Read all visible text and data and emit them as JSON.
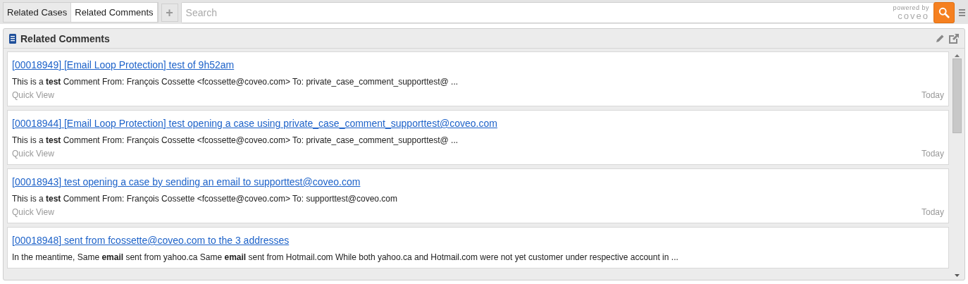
{
  "tabs": [
    {
      "label": "Related Cases",
      "selected": false
    },
    {
      "label": "Related Comments",
      "selected": true
    }
  ],
  "add_tab": "+",
  "search": {
    "placeholder": "Search",
    "powered_by": "powered by",
    "brand": "coveo"
  },
  "panel": {
    "title": "Related Comments",
    "results": [
      {
        "title": "[00018949] [Email Loop Protection] test of 9h52am",
        "excerpt": "This is a **test** Comment From: François Cossette <fcossette@coveo.com> To: private_case_comment_supporttest@ ...",
        "quick_view": "Quick View",
        "date": "Today"
      },
      {
        "title": "[00018944] [Email Loop Protection] test opening a case using private_case_comment_supporttest@coveo.com",
        "excerpt": "This is a **test** Comment From: François Cossette <fcossette@coveo.com> To: private_case_comment_supporttest@ ...",
        "quick_view": "Quick View",
        "date": "Today"
      },
      {
        "title": "[00018943] test opening a case by sending an email to supporttest@coveo.com",
        "excerpt": "This is a **test** Comment From: François Cossette <fcossette@coveo.com> To: supporttest@coveo.com",
        "quick_view": "Quick View",
        "date": "Today"
      },
      {
        "title": "[00018948] sent from fcossette@coveo.com to the 3 addresses",
        "excerpt": "In the meantime, Same **email** sent from yahoo.ca Same **email** sent from Hotmail.com While both yahoo.ca and Hotmail.com were not yet customer under respective account in ..."
      }
    ]
  }
}
